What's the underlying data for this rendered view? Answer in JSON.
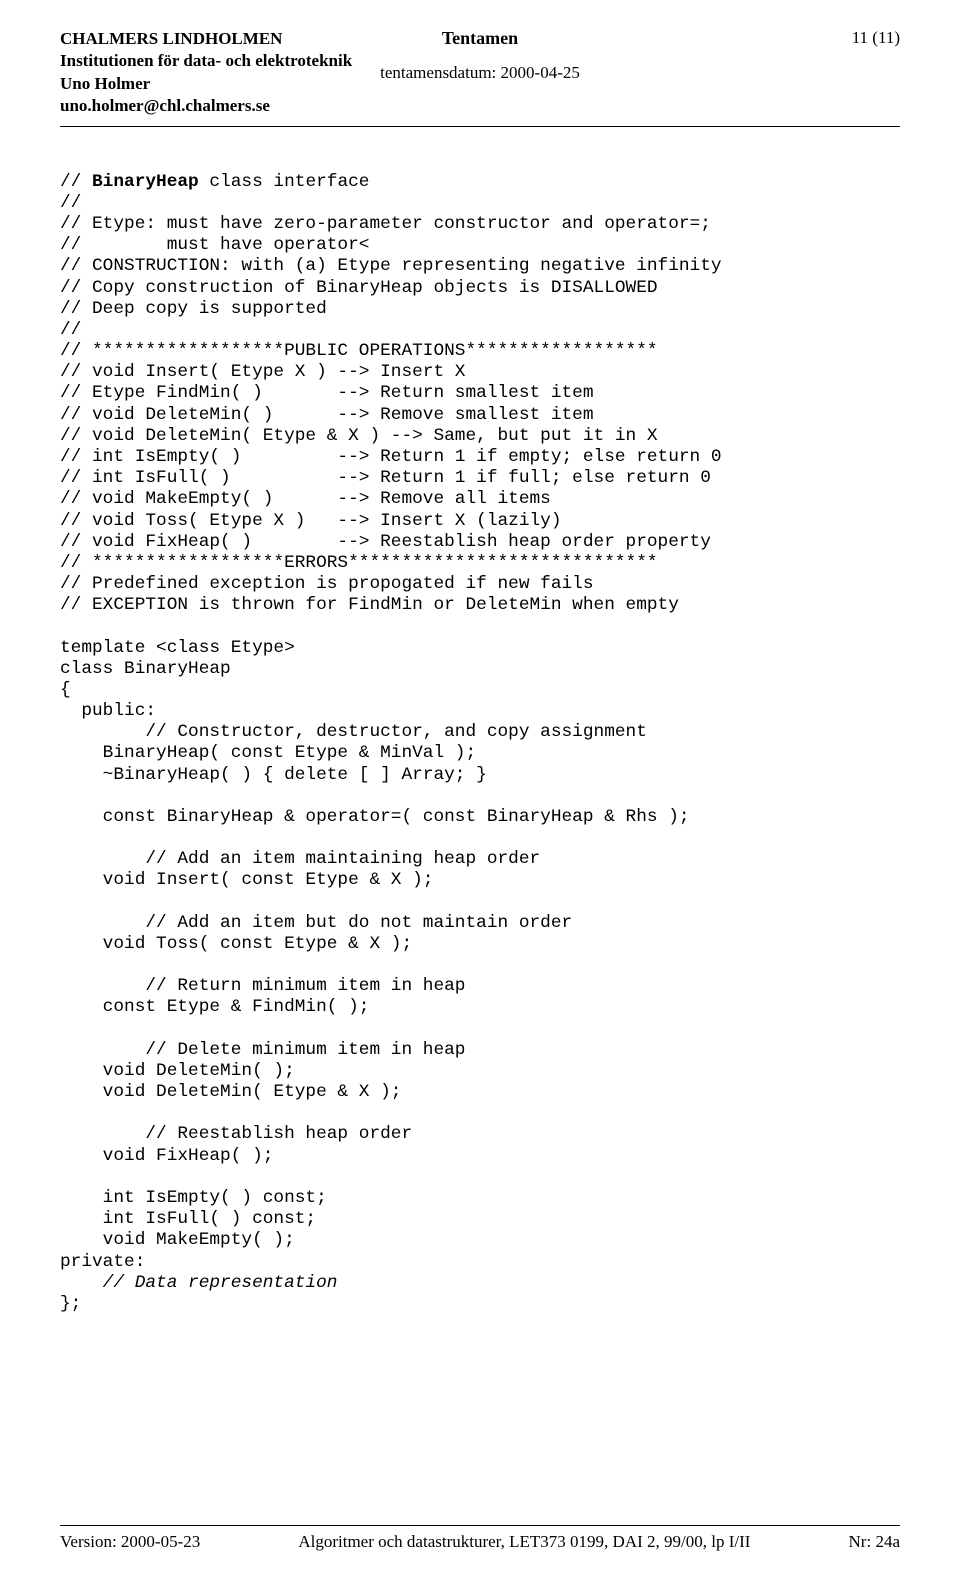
{
  "header": {
    "institution": "CHALMERS LINDHOLMEN",
    "department": "Institutionen för data- och elektroteknik",
    "author": "Uno Holmer",
    "email": "uno.holmer@chl.chalmers.se",
    "title": "Tentamen",
    "dateLabel": "tentamensdatum: 2000-04-25",
    "pageNum": "11 (11)"
  },
  "code": {
    "l01a": "// ",
    "l01b": "BinaryHeap",
    "l01c": " class interface",
    "l02": "//",
    "l03": "// Etype: must have zero-parameter constructor and operator=;",
    "l04": "//        must have operator<",
    "l05": "// CONSTRUCTION: with (a) Etype representing negative infinity",
    "l06": "// Copy construction of BinaryHeap objects is DISALLOWED",
    "l07": "// Deep copy is supported",
    "l08": "//",
    "l09": "// ******************PUBLIC OPERATIONS******************",
    "l10": "// void Insert( Etype X ) --> Insert X",
    "l11": "// Etype FindMin( )       --> Return smallest item",
    "l12": "// void DeleteMin( )      --> Remove smallest item",
    "l13": "// void DeleteMin( Etype & X ) --> Same, but put it in X",
    "l14": "// int IsEmpty( )         --> Return 1 if empty; else return 0",
    "l15": "// int IsFull( )          --> Return 1 if full; else return 0",
    "l16": "// void MakeEmpty( )      --> Remove all items",
    "l17": "// void Toss( Etype X )   --> Insert X (lazily)",
    "l18": "// void FixHeap( )        --> Reestablish heap order property",
    "l19": "// ******************ERRORS*****************************",
    "l20": "// Predefined exception is propogated if new fails",
    "l21": "// EXCEPTION is thrown for FindMin or DeleteMin when empty",
    "l22": "",
    "l23": "template <class Etype>",
    "l24": "class BinaryHeap",
    "l25": "{",
    "l26": "  public:",
    "l27": "        // Constructor, destructor, and copy assignment",
    "l28": "    BinaryHeap( const Etype & MinVal );",
    "l29": "    ~BinaryHeap( ) { delete [ ] Array; }",
    "l30": "",
    "l31": "    const BinaryHeap & operator=( const BinaryHeap & Rhs );",
    "l32": "",
    "l33": "        // Add an item maintaining heap order",
    "l34": "    void Insert( const Etype & X );",
    "l35": "",
    "l36": "        // Add an item but do not maintain order",
    "l37": "    void Toss( const Etype & X );",
    "l38": "",
    "l39": "        // Return minimum item in heap",
    "l40": "    const Etype & FindMin( );",
    "l41": "",
    "l42": "        // Delete minimum item in heap",
    "l43": "    void DeleteMin( );",
    "l44": "    void DeleteMin( Etype & X );",
    "l45": "",
    "l46": "        // Reestablish heap order",
    "l47": "    void FixHeap( );",
    "l48": "",
    "l49": "    int IsEmpty( ) const;",
    "l50": "    int IsFull( ) const;",
    "l51": "    void MakeEmpty( );",
    "l52": "private:",
    "l53": "    // Data representation",
    "l54": "};"
  },
  "footer": {
    "version": "Version: 2000-05-23",
    "course": "Algoritmer och datastrukturer, LET373 0199, DAI 2, 99/00, lp I/II",
    "nr": "Nr: 24a"
  }
}
